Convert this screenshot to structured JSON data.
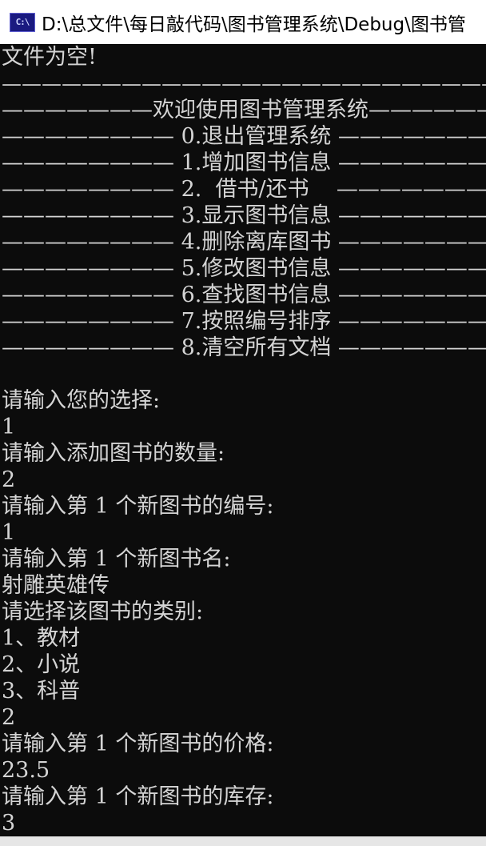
{
  "window": {
    "title": "D:\\总文件\\每日敲代码\\图书管理系统\\Debug\\图书管",
    "icon": "console-app-icon",
    "icon_text": "C:\\"
  },
  "console": {
    "lines": [
      "文件为空!",
      "————————————————————————————————",
      "———————欢迎使用图书管理系统———————",
      "———————— 0.退出管理系统 ————————",
      "———————— 1.增加图书信息 ————————",
      "———————— 2.  借书/还书    ————————",
      "———————— 3.显示图书信息 ————————",
      "———————— 4.删除离库图书 ————————",
      "———————— 5.修改图书信息 ————————",
      "———————— 6.查找图书信息 ————————",
      "———————— 7.按照编号排序 ————————",
      "———————— 8.清空所有文档 ————————",
      "",
      "请输入您的选择:",
      "1",
      "请输入添加图书的数量:",
      "2",
      "请输入第 1 个新图书的编号:",
      "1",
      "请输入第 1 个新图书名:",
      "射雕英雄传",
      "请选择该图书的类别:",
      "1、教材",
      "2、小说",
      "3、科普",
      "2",
      "请输入第 1 个新图书的价格:",
      "23.5",
      "请输入第 1 个新图书的库存:",
      "3"
    ]
  },
  "colors": {
    "console_bg": "#0c0c0c",
    "console_fg": "#d4d4d4",
    "titlebar_bg": "#ffffff"
  }
}
